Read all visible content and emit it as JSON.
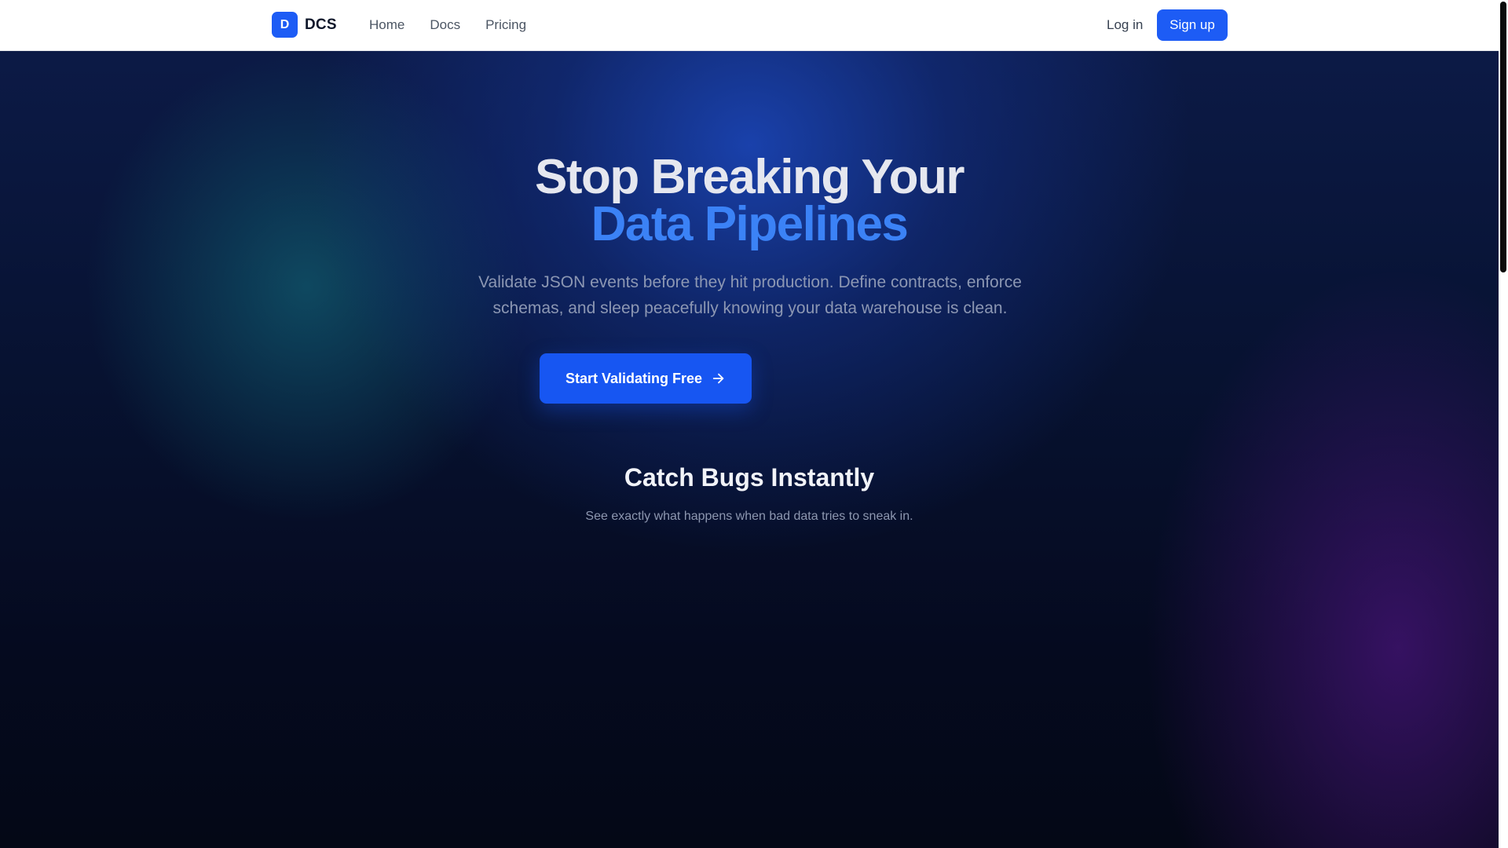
{
  "header": {
    "logo_letter": "D",
    "brand": "DCS",
    "nav": [
      "Home",
      "Docs",
      "Pricing"
    ],
    "login": "Log in",
    "signup": "Sign up"
  },
  "hero": {
    "headline_line1": "Stop Breaking Your",
    "headline_line2": "Data Pipelines",
    "subtitle": "Validate JSON events before they hit production. Define contracts, enforce schemas, and sleep peacefully knowing your data warehouse is clean.",
    "cta": "Start Validating Free",
    "cta_icon": "arrow-right-icon"
  },
  "section": {
    "title": "Catch Bugs Instantly",
    "subtitle": "See exactly what happens when bad data tries to sneak in."
  },
  "colors": {
    "accent": "#1d5cf5",
    "headline_highlight": "#3b82f6"
  }
}
